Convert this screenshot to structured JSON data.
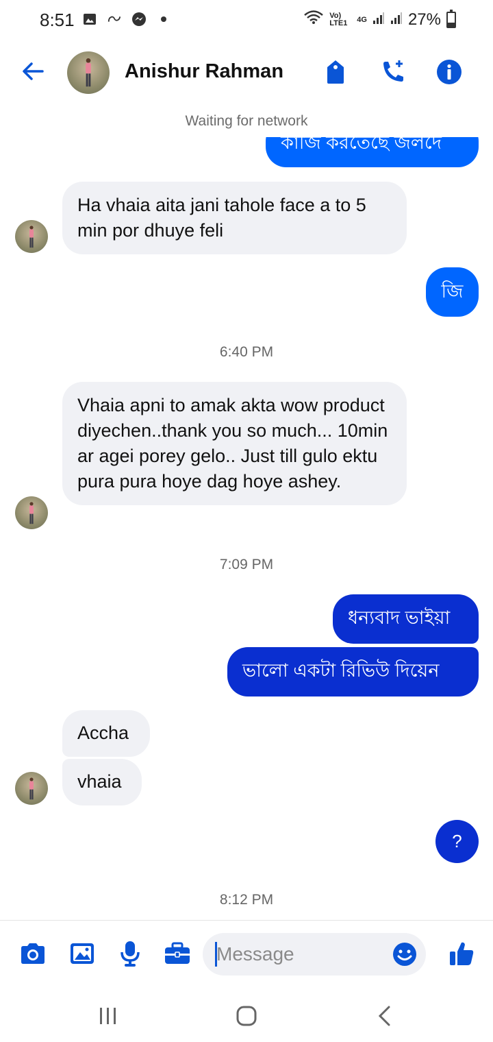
{
  "status_bar": {
    "time": "8:51",
    "network_label": "Vo) LTE1",
    "network_type": "4G",
    "battery": "27%"
  },
  "header": {
    "contact_name": "Anishur Rahman"
  },
  "network_status": "Waiting for network",
  "messages": [
    {
      "direction": "outgoing",
      "text": "কাজি করতেছে জলদে"
    },
    {
      "direction": "incoming",
      "text": "Ha vhaia aita jani tahole face a to 5 min por dhuye feli"
    },
    {
      "direction": "outgoing",
      "text": "জি"
    },
    {
      "direction": "incoming",
      "text": "Vhaia apni to amak akta wow product diyechen..thank you so much... 10min ar agei porey gelo.. Just till gulo ektu pura pura hoye dag hoye ashey."
    },
    {
      "direction": "outgoing",
      "text": "ধন্যবাদ ভাইয়া"
    },
    {
      "direction": "outgoing",
      "text": "ভালো একটা রিভিউ দিয়েন"
    },
    {
      "direction": "incoming",
      "text": "Accha"
    },
    {
      "direction": "incoming",
      "text": "vhaia"
    },
    {
      "direction": "outgoing",
      "text": "?"
    }
  ],
  "timestamps": [
    "6:40 PM",
    "7:09 PM",
    "8:12 PM"
  ],
  "composer": {
    "placeholder": "Message"
  },
  "colors": {
    "accent": "#0066ff",
    "dark_bubble": "#0a2fd0",
    "incoming_bubble": "#f0f1f5",
    "icon_blue": "#0a55d6"
  }
}
